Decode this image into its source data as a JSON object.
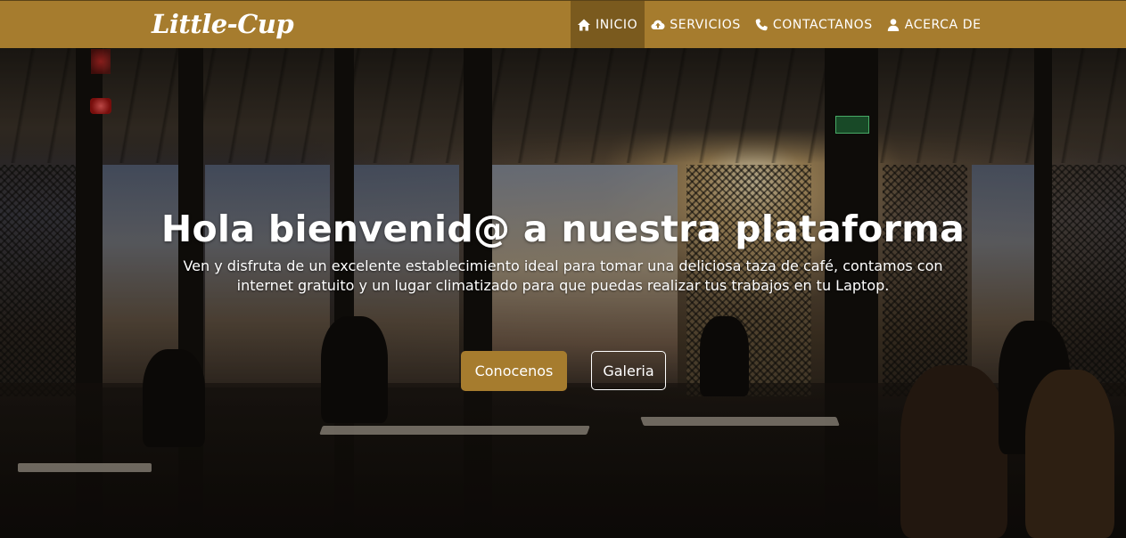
{
  "brand": {
    "name": "Little-Cup"
  },
  "nav": {
    "items": [
      {
        "label": "INICIO",
        "icon": "home-icon",
        "active": true
      },
      {
        "label": "SERVICIOS",
        "icon": "cloud-upload-icon",
        "active": false
      },
      {
        "label": "CONTACTANOS",
        "icon": "phone-icon",
        "active": false
      },
      {
        "label": "ACERCA DE",
        "icon": "user-icon",
        "active": false
      }
    ]
  },
  "hero": {
    "title": "Hola bienvenid@ a nuestra plataforma",
    "text": "Ven y disfruta de un excelente establecimiento ideal para tomar una deliciosa taza de café, contamos con internet gratuito y un lugar climatizado para que puedas realizar tus trabajos en tu Laptop.",
    "primary_button": "Conocenos",
    "secondary_button": "Galeria"
  },
  "colors": {
    "brand": "#a67c2e",
    "nav_active": "#7a5a1e",
    "text": "#ffffff"
  }
}
